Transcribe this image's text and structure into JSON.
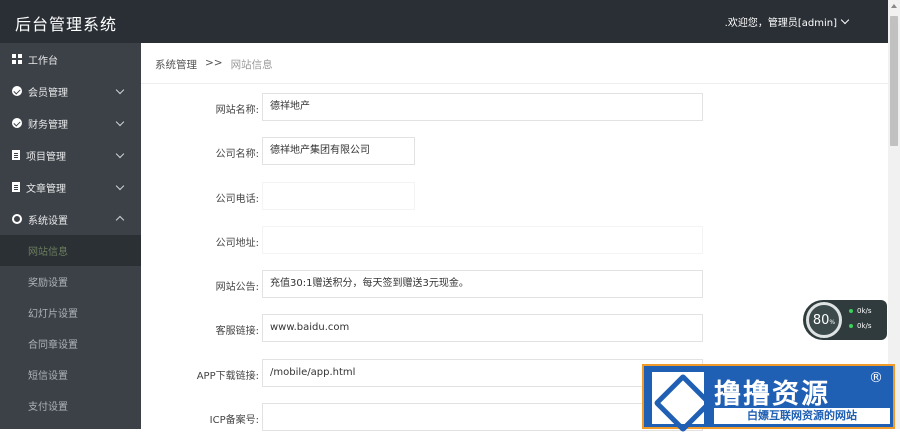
{
  "header": {
    "title": "后台管理系统",
    "welcome": ".欢迎您，管理员[admin]"
  },
  "sidebar": {
    "items": [
      {
        "label": "工作台",
        "icon": "grid-icon"
      },
      {
        "label": "会员管理",
        "icon": "check-circle-icon"
      },
      {
        "label": "财务管理",
        "icon": "check-circle-icon"
      },
      {
        "label": "项目管理",
        "icon": "document-icon"
      },
      {
        "label": "文章管理",
        "icon": "document-icon"
      },
      {
        "label": "系统设置",
        "icon": "gear-icon"
      }
    ],
    "sub_items": [
      {
        "label": "网站信息"
      },
      {
        "label": "奖励设置"
      },
      {
        "label": "幻灯片设置"
      },
      {
        "label": "合同章设置"
      },
      {
        "label": "短信设置"
      },
      {
        "label": "支付设置"
      }
    ]
  },
  "breadcrumb": {
    "parent": "系统管理",
    "separator": ">>",
    "current": "网站信息"
  },
  "form": {
    "site_name_label": "网站名称:",
    "site_name_value": "德祥地产",
    "company_name_label": "公司名称:",
    "company_name_value": "德祥地产集团有限公司",
    "company_phone_label": "公司电话:",
    "company_phone_value": "",
    "company_address_label": "公司地址:",
    "company_address_value": "",
    "notice_label": "网站公告:",
    "notice_value": "充值30:1赠送积分，每天签到赠送3元现金。",
    "service_link_label": "客服链接:",
    "service_link_value": "www.baidu.com",
    "app_link_label": "APP下载链接:",
    "app_link_value": "/mobile/app.html",
    "icp_label": "ICP备案号:",
    "icp_value": ""
  },
  "speed_widget": {
    "percent": "80",
    "unit": "%",
    "up": "0k/s",
    "down": "0k/s"
  },
  "watermark": {
    "title": "撸撸资源",
    "reg": "®",
    "subtitle": "白嫖互联网资源的网站"
  }
}
